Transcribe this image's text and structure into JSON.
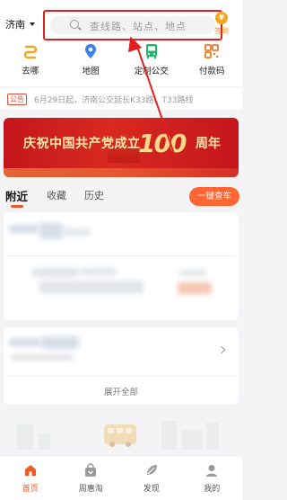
{
  "header": {
    "city": "济南",
    "search_placeholder": "查线路、站点、地点",
    "signin_label": "签到"
  },
  "quick_actions": [
    {
      "label": "去哪",
      "icon": "route-icon",
      "color": "#f2a81d"
    },
    {
      "label": "地图",
      "icon": "map-pin-icon",
      "color": "#3a82f0"
    },
    {
      "label": "定制公交",
      "icon": "bus-icon",
      "color": "#1fb86b"
    },
    {
      "label": "付款码",
      "icon": "qr-code-icon",
      "color": "#f07a24"
    }
  ],
  "notice": {
    "tag": "公告",
    "text": "6月29日起，济南公交延长K33路、T33路线"
  },
  "banner": {
    "title": "庆祝中国共产党成立",
    "number": "100",
    "suffix": "周年"
  },
  "tabs": {
    "items": [
      "附近",
      "收藏",
      "历史"
    ],
    "active": "附近",
    "query_button": "一键查车"
  },
  "card2": {
    "expand_label": "展开全部"
  },
  "tabbar": {
    "items": [
      {
        "label": "首页",
        "icon": "home-icon",
        "active": true
      },
      {
        "label": "周惠淘",
        "icon": "shopping-bag-icon",
        "active": false
      },
      {
        "label": "发现",
        "icon": "leaf-icon",
        "active": false
      },
      {
        "label": "我的",
        "icon": "user-icon",
        "active": false
      }
    ]
  },
  "colors": {
    "accent": "#f05a24",
    "highlight_border": "#e02020",
    "banner_red": "#c4161c"
  }
}
